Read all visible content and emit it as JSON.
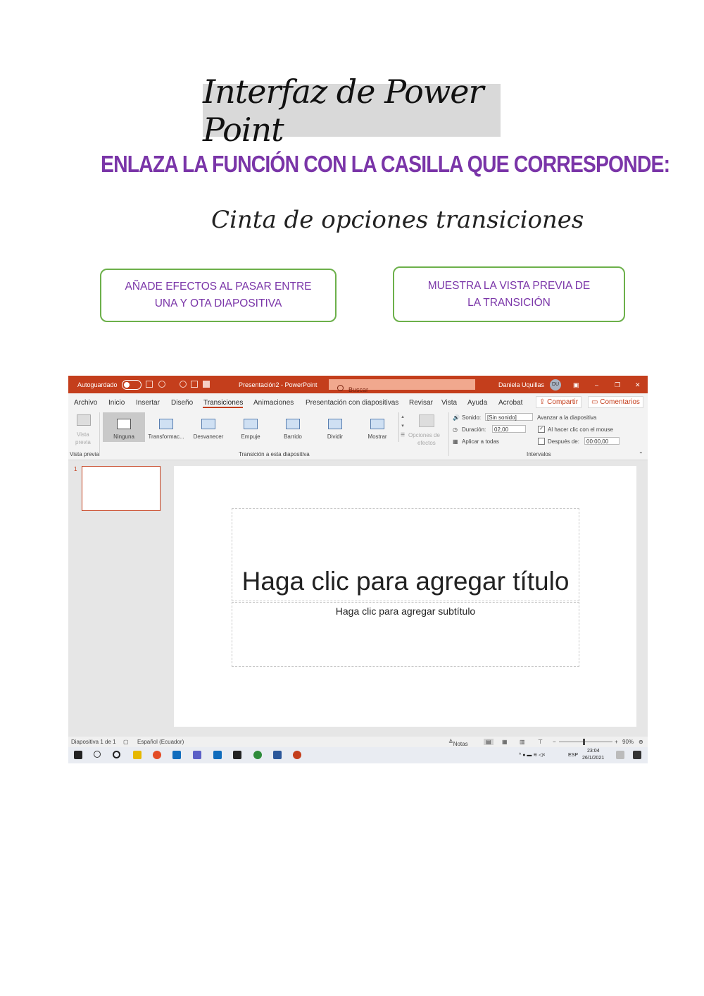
{
  "worksheet": {
    "title": "Interfaz de Power Point",
    "instruction": "ENLAZA LA FUNCIÓN CON LA CASILLA QUE CORRESPONDE:",
    "subtitle": "Cinta de opciones transiciones",
    "answer_boxes": [
      "AÑADE EFECTOS AL PASAR ENTRE UNA Y OTA DIAPOSITIVA",
      "MUESTRA LA VISTA PREVIA DE LA TRANSICIÓN"
    ]
  },
  "screenshot": {
    "titlebar": {
      "autosave": "Autoguardado",
      "doc_title": "Presentación2 - PowerPoint",
      "search_placeholder": "Buscar",
      "user_name": "Daniela Uquillas",
      "user_initials": "DU",
      "accent_color": "#c43e1c"
    },
    "menu_tabs": [
      "Archivo",
      "Inicio",
      "Insertar",
      "Diseño",
      "Transiciones",
      "Animaciones",
      "Presentación con diapositivas",
      "Revisar",
      "Vista",
      "Ayuda",
      "Acrobat"
    ],
    "active_tab": "Transiciones",
    "share_label": "Compartir",
    "comments_label": "Comentarios",
    "ribbon": {
      "preview_label_1": "Vista",
      "preview_label_2": "previa",
      "preview_group": "Vista previa",
      "transitions": [
        "Ninguna",
        "Transformac...",
        "Desvanecer",
        "Empuje",
        "Barrido",
        "Dividir",
        "Mostrar"
      ],
      "selected_transition": "Ninguna",
      "effect_options_1": "Opciones de",
      "effect_options_2": "efectos",
      "transition_group": "Transición a esta diapositiva",
      "sound_label": "Sonido:",
      "sound_value": "[Sin sonido]",
      "duration_label": "Duración:",
      "duration_value": "02,00",
      "apply_all": "Aplicar a todas",
      "advance_label": "Avanzar a la diapositiva",
      "on_click": "Al hacer clic con el mouse",
      "after_label": "Después de:",
      "after_value": "00:00,00",
      "timing_group": "Intervalos"
    },
    "slide_panel": {
      "slide_number": "1"
    },
    "slide": {
      "title_placeholder": "Haga clic para agregar título",
      "subtitle_placeholder": "Haga clic para agregar subtítulo"
    },
    "statusbar": {
      "slide_info": "Diapositiva 1 de 1",
      "language": "Español (Ecuador)",
      "notes": "Notas",
      "zoom": "90%"
    },
    "taskbar": {
      "lang": "ESP",
      "time": "23:04",
      "date": "26/1/2021"
    }
  }
}
